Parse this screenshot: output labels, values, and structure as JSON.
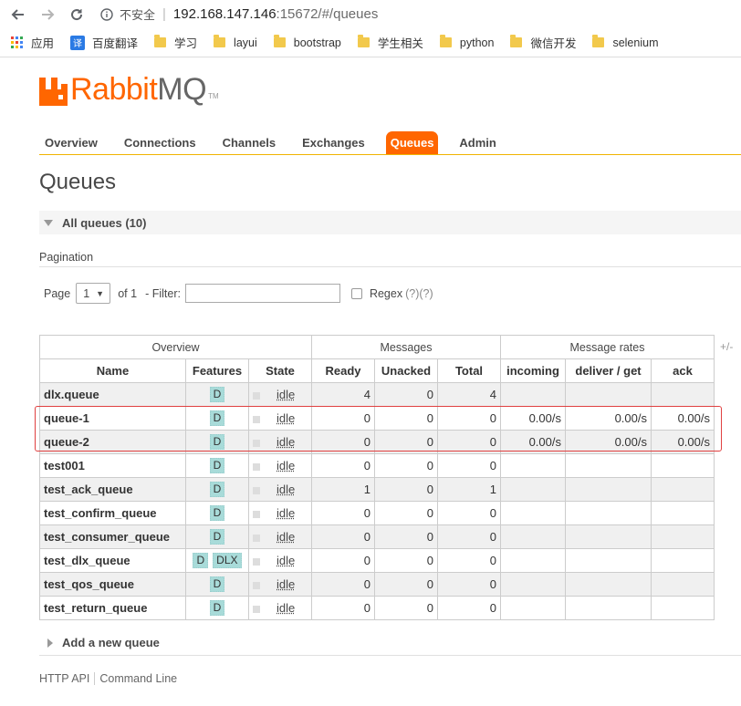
{
  "browser": {
    "url_security": "不安全",
    "url_host": "192.168.147.146",
    "url_path": ":15672/#/queues",
    "bookmarks": [
      {
        "label": "应用",
        "icon": "apps-icon"
      },
      {
        "label": "百度翻译",
        "icon": "translate-icon"
      },
      {
        "label": "学习",
        "icon": "folder-icon"
      },
      {
        "label": "layui",
        "icon": "folder-icon"
      },
      {
        "label": "bootstrap",
        "icon": "folder-icon"
      },
      {
        "label": "学生相关",
        "icon": "folder-icon"
      },
      {
        "label": "python",
        "icon": "folder-icon"
      },
      {
        "label": "微信开发",
        "icon": "folder-icon"
      },
      {
        "label": "selenium",
        "icon": "folder-icon"
      }
    ]
  },
  "logo": {
    "rabbit": "Rabbit",
    "mq": "MQ",
    "tm": "TM"
  },
  "tabs": [
    {
      "label": "Overview"
    },
    {
      "label": "Connections"
    },
    {
      "label": "Channels"
    },
    {
      "label": "Exchanges"
    },
    {
      "label": "Queues",
      "active": true
    },
    {
      "label": "Admin"
    }
  ],
  "page_title": "Queues",
  "section_title": "All queues (10)",
  "pagination": {
    "label": "Pagination",
    "page_label": "Page",
    "page_value": "1",
    "of_label": "of 1",
    "filter_label": "- Filter:",
    "filter_value": "",
    "regex_label": "Regex",
    "help": "(?)(?)"
  },
  "table": {
    "groups": [
      "Overview",
      "Messages",
      "Message rates"
    ],
    "plus_minus": "+/-",
    "columns": [
      "Name",
      "Features",
      "State",
      "Ready",
      "Unacked",
      "Total",
      "incoming",
      "deliver / get",
      "ack"
    ],
    "rows": [
      {
        "name": "dlx.queue",
        "features": [
          "D"
        ],
        "state": "idle",
        "ready": "4",
        "unacked": "0",
        "total": "4",
        "incoming": "",
        "deliver": "",
        "ack": ""
      },
      {
        "name": "queue-1",
        "features": [
          "D"
        ],
        "state": "idle",
        "ready": "0",
        "unacked": "0",
        "total": "0",
        "incoming": "0.00/s",
        "deliver": "0.00/s",
        "ack": "0.00/s"
      },
      {
        "name": "queue-2",
        "features": [
          "D"
        ],
        "state": "idle",
        "ready": "0",
        "unacked": "0",
        "total": "0",
        "incoming": "0.00/s",
        "deliver": "0.00/s",
        "ack": "0.00/s"
      },
      {
        "name": "test001",
        "features": [
          "D"
        ],
        "state": "idle",
        "ready": "0",
        "unacked": "0",
        "total": "0",
        "incoming": "",
        "deliver": "",
        "ack": ""
      },
      {
        "name": "test_ack_queue",
        "features": [
          "D"
        ],
        "state": "idle",
        "ready": "1",
        "unacked": "0",
        "total": "1",
        "incoming": "",
        "deliver": "",
        "ack": ""
      },
      {
        "name": "test_confirm_queue",
        "features": [
          "D"
        ],
        "state": "idle",
        "ready": "0",
        "unacked": "0",
        "total": "0",
        "incoming": "",
        "deliver": "",
        "ack": ""
      },
      {
        "name": "test_consumer_queue",
        "features": [
          "D"
        ],
        "state": "idle",
        "ready": "0",
        "unacked": "0",
        "total": "0",
        "incoming": "",
        "deliver": "",
        "ack": ""
      },
      {
        "name": "test_dlx_queue",
        "features": [
          "D",
          "DLX"
        ],
        "state": "idle",
        "ready": "0",
        "unacked": "0",
        "total": "0",
        "incoming": "",
        "deliver": "",
        "ack": ""
      },
      {
        "name": "test_qos_queue",
        "features": [
          "D"
        ],
        "state": "idle",
        "ready": "0",
        "unacked": "0",
        "total": "0",
        "incoming": "",
        "deliver": "",
        "ack": ""
      },
      {
        "name": "test_return_queue",
        "features": [
          "D"
        ],
        "state": "idle",
        "ready": "0",
        "unacked": "0",
        "total": "0",
        "incoming": "",
        "deliver": "",
        "ack": ""
      }
    ]
  },
  "add_queue": "Add a new queue",
  "footer": [
    "HTTP API",
    "Command Line"
  ],
  "colors": {
    "accent": "#ff6600",
    "badge": "#a8dbd9",
    "highlight": "#e04040"
  }
}
